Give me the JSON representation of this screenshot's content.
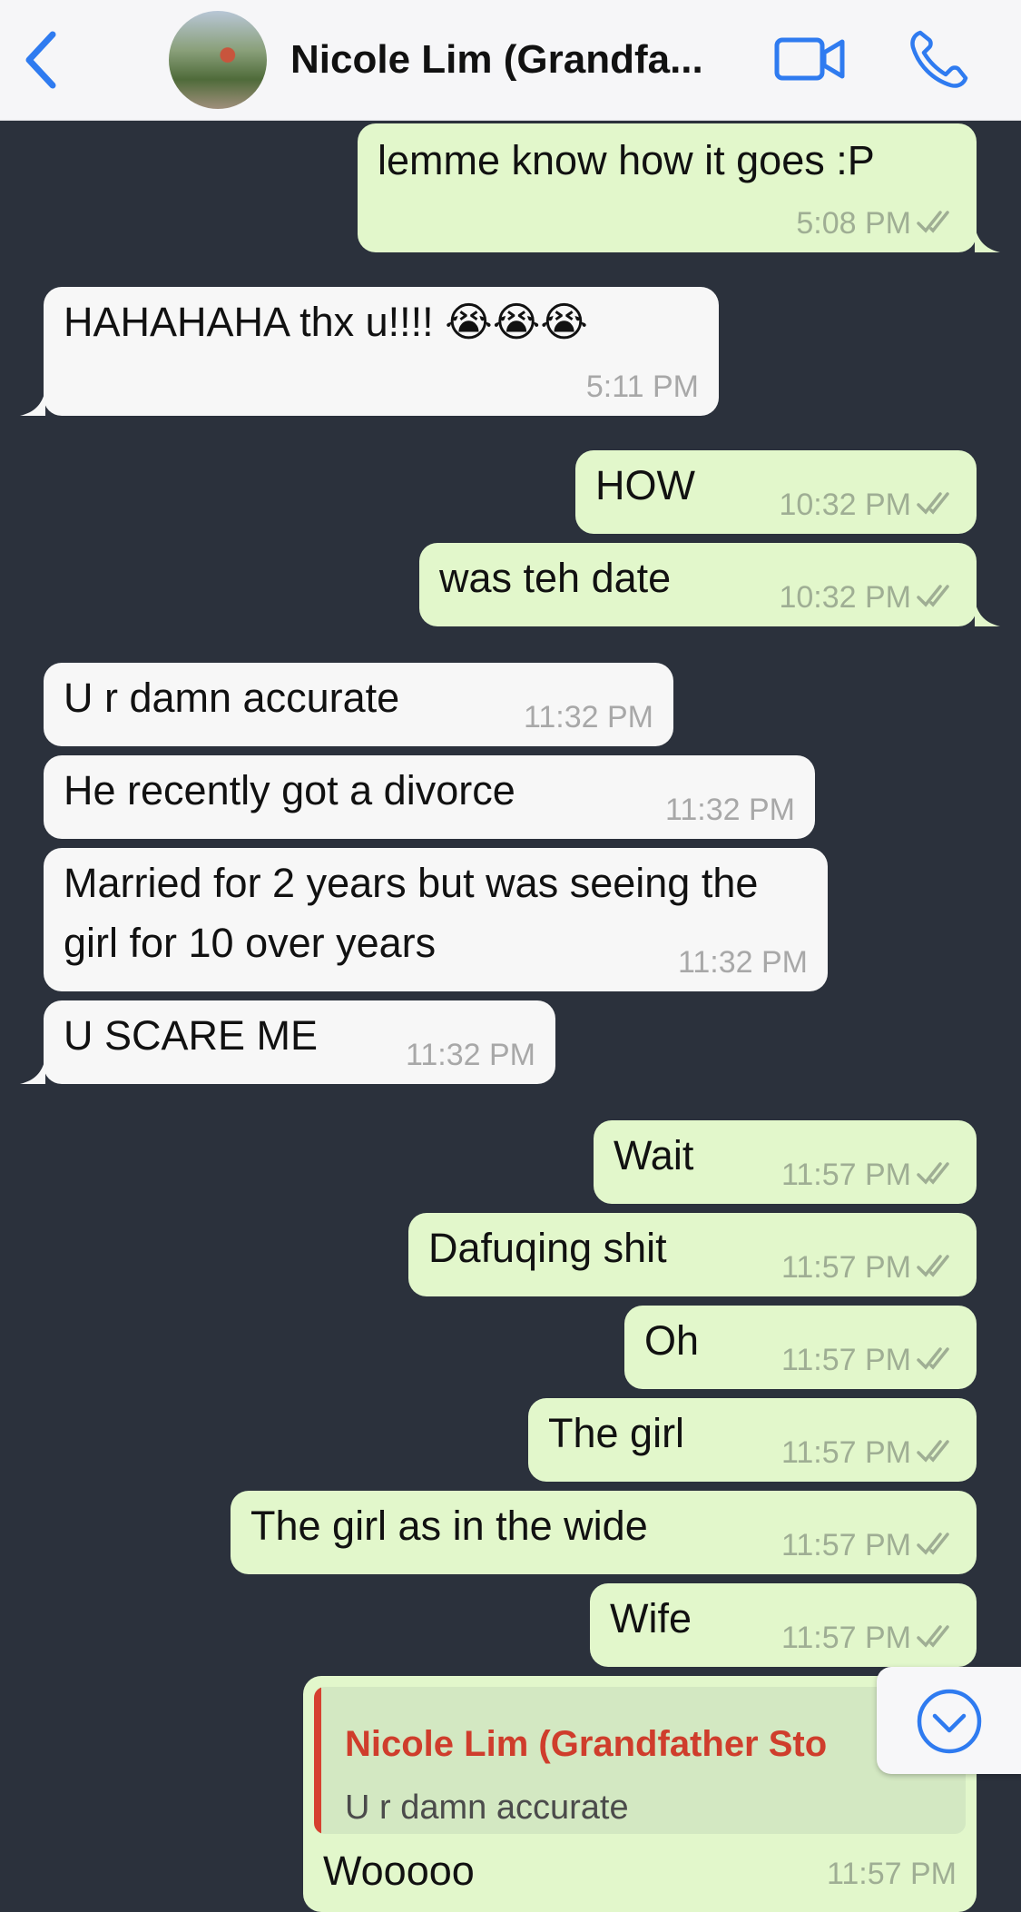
{
  "header": {
    "contact_name": "Nicole Lim (Grandfa...",
    "back_icon": "chevron-left-icon",
    "video_icon": "video-camera-icon",
    "call_icon": "phone-icon",
    "accent_color": "#2f7bf0"
  },
  "messages": [
    {
      "dir": "out",
      "text": "lemme know how it goes :P",
      "time": "5:08 PM",
      "read": true
    },
    {
      "dir": "in",
      "text": "HAHAHAHA thx u!!!! 😭😭😭",
      "time": "5:11 PM"
    },
    {
      "dir": "out",
      "text": "HOW",
      "time": "10:32 PM",
      "read": true
    },
    {
      "dir": "out",
      "text": "was teh date",
      "time": "10:32 PM",
      "read": true
    },
    {
      "dir": "in",
      "text": "U r damn accurate",
      "time": "11:32 PM"
    },
    {
      "dir": "in",
      "text": "He recently got a divorce",
      "time": "11:32 PM"
    },
    {
      "dir": "in",
      "text": "Married for 2 years but was seeing the girl for 10 over years",
      "time": "11:32 PM"
    },
    {
      "dir": "in",
      "text": "U SCARE ME",
      "time": "11:32 PM"
    },
    {
      "dir": "out",
      "text": "Wait",
      "time": "11:57 PM",
      "read": true
    },
    {
      "dir": "out",
      "text": "Dafuqing shit",
      "time": "11:57 PM",
      "read": true
    },
    {
      "dir": "out",
      "text": "Oh",
      "time": "11:57 PM",
      "read": true
    },
    {
      "dir": "out",
      "text": "The girl",
      "time": "11:57 PM",
      "read": true
    },
    {
      "dir": "out",
      "text": "The girl as in the wide",
      "time": "11:57 PM",
      "read": true
    },
    {
      "dir": "out",
      "text": "Wife",
      "time": "11:57 PM",
      "read": true
    },
    {
      "dir": "out",
      "reply_to_name": "Nicole Lim (Grandfather Sto",
      "reply_to_text": "U r damn accurate",
      "text": "Wooooo",
      "time": "11:57 PM"
    }
  ],
  "colors": {
    "background": "#2b313c",
    "incoming_bubble": "#f7f7f7",
    "outgoing_bubble": "#e2f7cb",
    "quote_name": "#cf3d2c",
    "ticks": "#9fae94"
  },
  "scroll_down_icon": "chevron-down-circle-icon"
}
